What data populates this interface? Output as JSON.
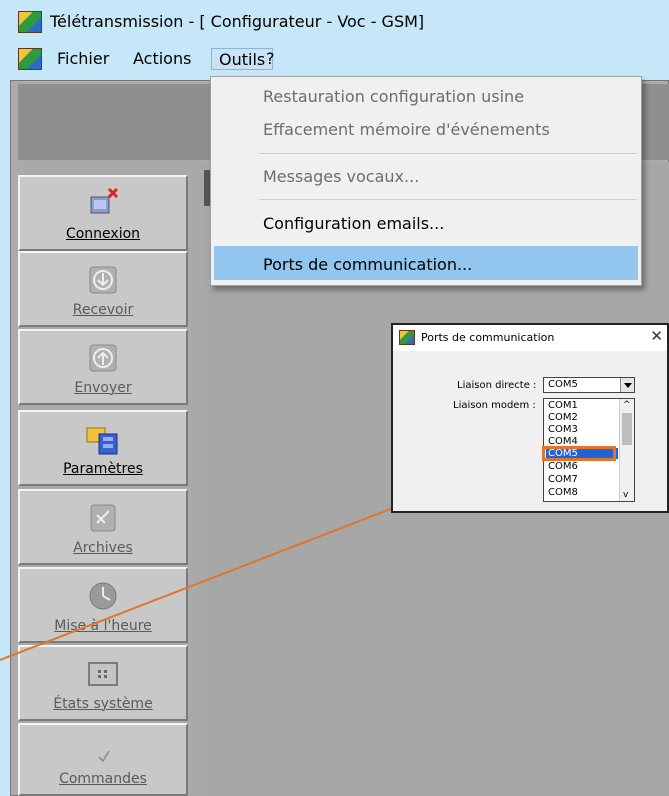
{
  "window": {
    "title": "Télétransmission - [ Configurateur - Voc - GSM]"
  },
  "menubar": {
    "items": [
      "Fichier",
      "Actions",
      "Outils",
      "?"
    ]
  },
  "outils_menu": {
    "items": [
      {
        "label": "Restauration configuration usine",
        "enabled": false
      },
      {
        "label": "Effacement mémoire d'événements",
        "enabled": false
      },
      {
        "label": "Messages vocaux...",
        "enabled": false
      },
      {
        "label": "Configuration emails...",
        "enabled": true
      },
      {
        "label": "Ports de communication...",
        "enabled": true,
        "highlighted": true
      }
    ]
  },
  "toolbar": {
    "buttons": [
      {
        "label": "Connexion",
        "icon": "connect-icon",
        "enabled": true
      },
      {
        "label": "Recevoir",
        "icon": "download-icon",
        "enabled": false
      },
      {
        "label": "Envoyer",
        "icon": "upload-icon",
        "enabled": false
      },
      {
        "label": "Paramètres",
        "icon": "settings-folder-icon",
        "enabled": true
      },
      {
        "label": "Archives",
        "icon": "archive-icon",
        "enabled": false
      },
      {
        "label": "Mise à l'heure",
        "icon": "clock-icon",
        "enabled": false
      },
      {
        "label": "États système",
        "icon": "system-status-icon",
        "enabled": false
      },
      {
        "label": "Commandes",
        "icon": "command-icon",
        "enabled": false
      }
    ]
  },
  "dialog": {
    "title": "Ports de communication",
    "close": "✕",
    "liaison_directe_label": "Liaison directe :",
    "liaison_modem_label": "Liaison modem :",
    "selected_value": "COM5",
    "options": [
      "COM1",
      "COM2",
      "COM3",
      "COM4",
      "COM5",
      "COM6",
      "COM7",
      "COM8"
    ],
    "scroll_up": "^",
    "scroll_down": "v"
  },
  "colors": {
    "background": "#c6e7f8",
    "menu_highlight": "#92c6ef",
    "list_selection": "#1f63d6",
    "callout": "#e2742c"
  }
}
